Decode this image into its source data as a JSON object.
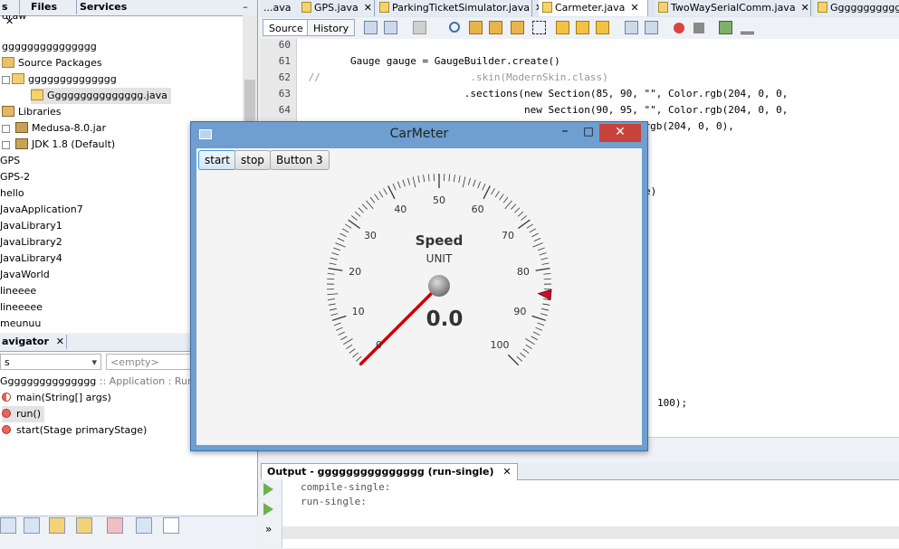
{
  "projects_panel": {
    "tabs": [
      {
        "label": "s",
        "close": "✕"
      },
      {
        "label": "Files"
      },
      {
        "label": "Services"
      }
    ],
    "minimize": "–",
    "tree": [
      {
        "label": "draw"
      },
      {
        "label": "ggggggggggggggg"
      },
      {
        "label": "Source Packages"
      },
      {
        "label": "gggggggggggggg"
      },
      {
        "label": "Ggggggggggggggg.java"
      },
      {
        "label": "Libraries"
      },
      {
        "label": "Medusa-8.0.jar"
      },
      {
        "label": "JDK 1.8 (Default)"
      },
      {
        "label": "GPS"
      },
      {
        "label": "GPS-2"
      },
      {
        "label": "hello"
      },
      {
        "label": "JavaApplication7"
      },
      {
        "label": "JavaLibrary1"
      },
      {
        "label": "JavaLibrary2"
      },
      {
        "label": "JavaLibrary4"
      },
      {
        "label": "JavaWorld"
      },
      {
        "label": "lineeee"
      },
      {
        "label": "lineeeee"
      },
      {
        "label": "meunuu"
      }
    ]
  },
  "navigator_panel": {
    "tab_label": "avigator",
    "close": "✕",
    "combo_left": "s",
    "combo_right_placeholder": "<empty>",
    "class_name": "Ggggggggggggggg",
    "class_suffix": " :: Application : Runnable",
    "members": [
      {
        "name": "main(String[] args)"
      },
      {
        "name": "run()"
      },
      {
        "name": "start(Stage primaryStage)"
      }
    ]
  },
  "editor": {
    "tabs": [
      {
        "label": "...ava"
      },
      {
        "label": "GPS.java"
      },
      {
        "label": "ParkingTicketSimulator.java"
      },
      {
        "label": "Carmeter.java"
      },
      {
        "label": "TwoWaySerialComm.java"
      },
      {
        "label": "Gggggggggggggg"
      }
    ],
    "source_tab": "Source",
    "history_tab": "History",
    "line_numbers": [
      "60",
      "61",
      "62",
      "63",
      "64"
    ],
    "code_lines": [
      {
        "text": ""
      },
      {
        "text": "        Gauge gauge = GaugeBuilder.create()"
      },
      {
        "text": " //                         .skin(ModernSkin.class)"
      },
      {
        "text": "                           .sections(new Section(85, 90, \"\", Color.rgb(204, 0, 0,"
      },
      {
        "text": "                                     new Section(90, 95, \"\", Color.rgb(204, 0, 0,"
      },
      {
        "text": "                                    n(95, 100, \"\", Color.rgb(204, 0, 0),"
      },
      {
        "text": "e)"
      },
      {
        "text": "100);"
      }
    ]
  },
  "output": {
    "tab_label": "Output - ggggggggggggggg (run-single)",
    "close": "✕",
    "lines": [
      "compile-single:",
      "run-single:"
    ],
    "side_more": "»"
  },
  "dialog": {
    "title": "CarMeter",
    "minimize": "–",
    "maximize": "□",
    "close": "✕",
    "buttons": [
      {
        "label": "start"
      },
      {
        "label": "stop"
      },
      {
        "label": "Button 3"
      }
    ],
    "gauge": {
      "title": "Speed",
      "unit": "UNIT",
      "value_text": "0.0",
      "value": 0,
      "min": 0,
      "max": 100,
      "tick_labels": [
        "0",
        "10",
        "20",
        "30",
        "40",
        "50",
        "60",
        "70",
        "80",
        "90",
        "100"
      ],
      "needle_color": "#cc0000",
      "marker_value": 85
    }
  }
}
